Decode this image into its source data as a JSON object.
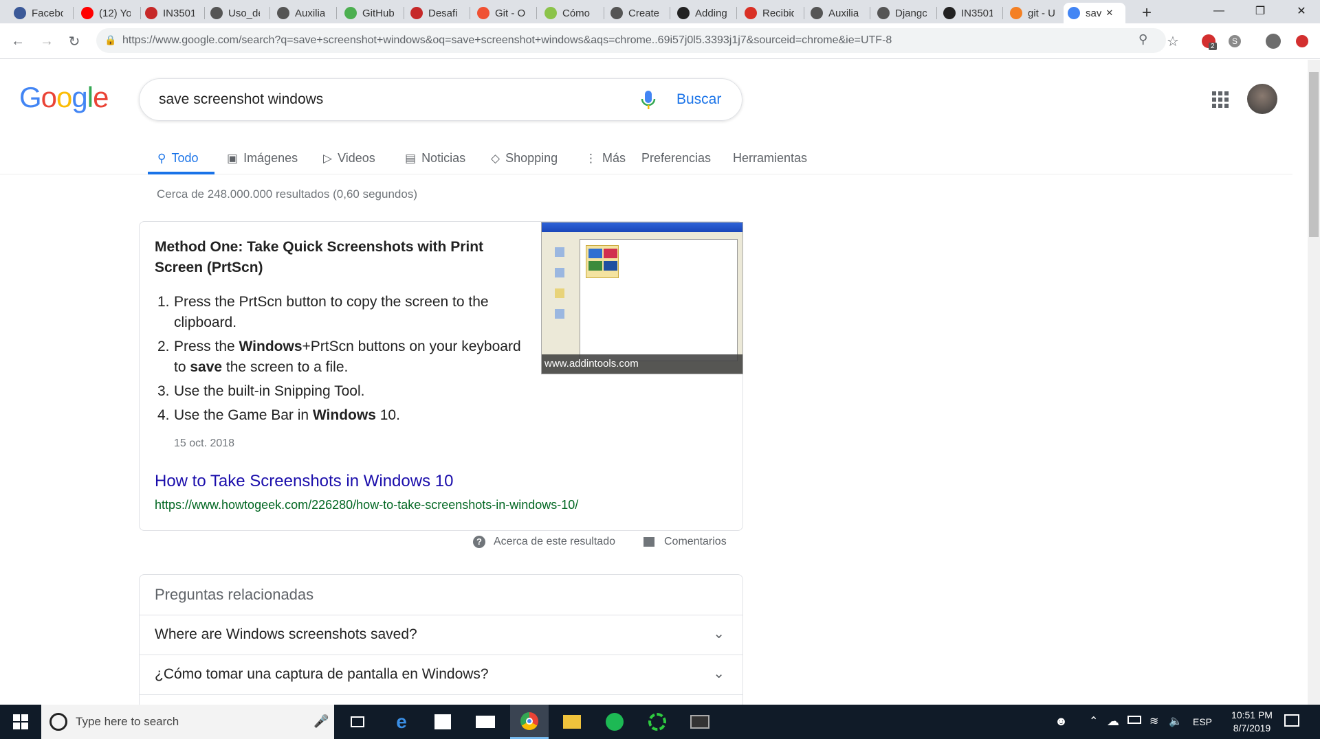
{
  "browser": {
    "tabs": [
      {
        "title": "Facebo",
        "icon": "facebook-icon",
        "color": "#3b5998"
      },
      {
        "title": "(12) Yo",
        "icon": "youtube-icon",
        "color": "#ff0000"
      },
      {
        "title": "IN3501",
        "icon": "university-icon",
        "color": "#c62828"
      },
      {
        "title": "Uso_de",
        "icon": "globe-icon",
        "color": "#555555"
      },
      {
        "title": "Auxilia",
        "icon": "globe-icon",
        "color": "#555555"
      },
      {
        "title": "GitHub",
        "icon": "github-icon",
        "color": "#4caf50"
      },
      {
        "title": "Desafi",
        "icon": "university-icon",
        "color": "#c62828"
      },
      {
        "title": "Git - O",
        "icon": "git-icon",
        "color": "#f05133"
      },
      {
        "title": "Cómo",
        "icon": "dev-icon",
        "color": "#8bc34a"
      },
      {
        "title": "Create",
        "icon": "globe-icon",
        "color": "#555555"
      },
      {
        "title": "Adding",
        "icon": "github-icon",
        "color": "#222222"
      },
      {
        "title": "Recibid",
        "icon": "gmail-icon",
        "color": "#d93025"
      },
      {
        "title": "Auxilia",
        "icon": "globe-icon",
        "color": "#555555"
      },
      {
        "title": "Djangc",
        "icon": "globe-icon",
        "color": "#555555"
      },
      {
        "title": "IN3501",
        "icon": "github-icon",
        "color": "#222222"
      },
      {
        "title": "git - U",
        "icon": "stackoverflow-icon",
        "color": "#f48024"
      },
      {
        "title": "sav",
        "icon": "google-icon",
        "color": "#4285f4",
        "active": true
      }
    ],
    "new_tab": "+",
    "url": "https://www.google.com/search?q=save+screenshot+windows&oq=save+screenshot+windows&aqs=chrome..69i57j0l5.3393j1j7&sourceid=chrome&ie=UTF-8",
    "extension_badge": "2"
  },
  "google": {
    "logo": [
      "G",
      "o",
      "o",
      "g",
      "l",
      "e"
    ],
    "logo_colors": [
      "#4285f4",
      "#ea4335",
      "#fbbc05",
      "#4285f4",
      "#34a853",
      "#ea4335"
    ],
    "query": "save screenshot windows",
    "search_button": "Buscar",
    "nav": [
      "Todo",
      "Imágenes",
      "Videos",
      "Noticias",
      "Shopping",
      "Más",
      "Preferencias",
      "Herramientas"
    ],
    "stats": "Cerca de 248.000.000 resultados (0,60 segundos)"
  },
  "snippet": {
    "title": "Method One: Take Quick Screenshots with Print Screen (PrtScn)",
    "steps": [
      {
        "num": "1.",
        "parts": [
          {
            "t": "Press the PrtScn button to copy the screen to the clipboard.",
            "b": false
          }
        ]
      },
      {
        "num": "2.",
        "parts": [
          {
            "t": "Press the ",
            "b": false
          },
          {
            "t": "Windows",
            "b": true
          },
          {
            "t": "+PrtScn buttons on your keyboard to ",
            "b": false
          },
          {
            "t": "save",
            "b": true
          },
          {
            "t": " the screen to a file.",
            "b": false
          }
        ]
      },
      {
        "num": "3.",
        "parts": [
          {
            "t": "Use the built-in Snipping Tool.",
            "b": false
          }
        ]
      },
      {
        "num": "4.",
        "parts": [
          {
            "t": "Use the Game Bar in ",
            "b": false
          },
          {
            "t": "Windows",
            "b": true
          },
          {
            "t": " 10.",
            "b": false
          }
        ]
      }
    ],
    "date": "15 oct. 2018",
    "link_text": "How to Take Screenshots in Windows 10",
    "link_url": "https://www.howtogeek.com/226280/how-to-take-screenshots-in-windows-10/",
    "image_caption": "www.addintools.com",
    "about": "Acerca de este resultado",
    "comments": "Comentarios"
  },
  "related": {
    "heading": "Preguntas relacionadas",
    "questions": [
      "Where are Windows screenshots saved?",
      "¿Cómo tomar una captura de pantalla en Windows?"
    ]
  },
  "taskbar": {
    "search_placeholder": "Type here to search",
    "language": "ESP",
    "time": "10:51 PM",
    "date": "8/7/2019"
  }
}
